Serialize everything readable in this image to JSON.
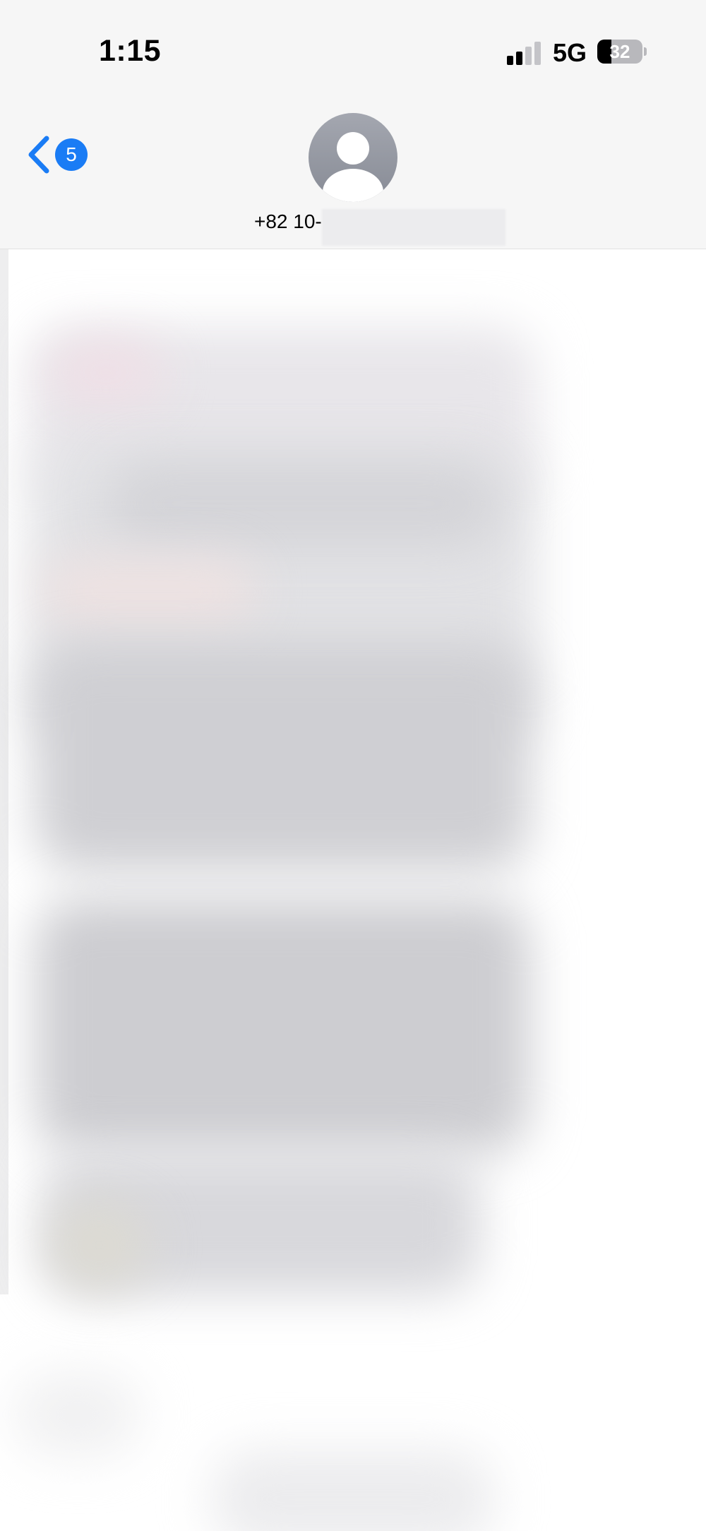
{
  "status_bar": {
    "time": "1:15",
    "network": "5G",
    "battery_percent": "32",
    "signal_bars_active": 2,
    "signal_bars_total": 4
  },
  "nav": {
    "unread_count": "5",
    "contact_name": "+82 10-"
  },
  "colors": {
    "accent": "#1a7cf5",
    "header_bg": "#f6f6f6",
    "avatar_gray": "#8e929c"
  },
  "icons": {
    "back": "chevron-left-icon",
    "avatar": "person-silhouette-icon"
  }
}
